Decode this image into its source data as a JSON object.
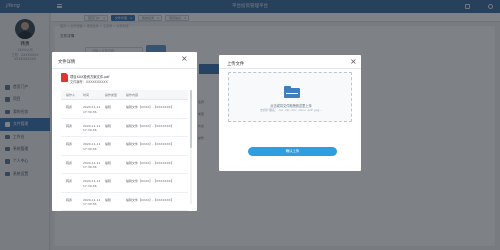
{
  "app": {
    "logo": "jifeng",
    "system_title": "平台投资管理平台"
  },
  "user": {
    "name": "韩勇",
    "line1": "XXXX公司",
    "line2": "工号：XXXXXXXX",
    "line3": "XXXXXXXXXX"
  },
  "sidebar": {
    "items": [
      {
        "label": "首页门户",
        "active": false
      },
      {
        "label": "项目",
        "active": false
      },
      {
        "label": "我的任务",
        "active": false
      },
      {
        "label": "文件管理",
        "active": true
      },
      {
        "label": "工作台",
        "active": false
      },
      {
        "label": "系统管理",
        "active": false
      },
      {
        "label": "个人中心",
        "active": false
      },
      {
        "label": "系统设置",
        "active": false
      }
    ]
  },
  "tabs": [
    {
      "label": "首页门户",
      "active": false
    },
    {
      "label": "文件管理",
      "active": true
    },
    {
      "label": "我的任务",
      "active": false
    },
    {
      "label": "项目信息",
      "active": false
    }
  ],
  "background": {
    "breadcrumb": "首页 > 文件管理 > 项目文件 > 子目录 > 文件列表",
    "page_title": "文件详情",
    "search_placeholder": "请输入文件名称",
    "peek_labels": [
      "名称",
      "类型",
      "状态",
      "操作"
    ]
  },
  "file_modal": {
    "title": "文件详情",
    "file_name": "项目XXX投资方案文件.pdf",
    "file_code": "文件编号：XXXXXXXXXX",
    "columns": [
      "操作人",
      "时间",
      "操作类型",
      "操作内容"
    ],
    "rows": [
      {
        "operator": "韩勇",
        "time": "2020-11-11 17:30:36",
        "type": "编辑",
        "content": "编辑文件【XXXX】-【XXXXXXX】"
      },
      {
        "operator": "韩勇",
        "time": "2020-11-11 17:30:36",
        "type": "编辑",
        "content": "编辑文件【XXXX】-【XXXXXXX】"
      },
      {
        "operator": "韩勇",
        "time": "2020-11-11 17:30:36",
        "type": "编辑",
        "content": "编辑文件【XXXX】-【XXXXXXX】"
      },
      {
        "operator": "韩勇",
        "time": "2020-11-11 17:30:36",
        "type": "编辑",
        "content": "编辑文件【XXXX】-【XXXXXXX】"
      },
      {
        "operator": "韩勇",
        "time": "2020-11-11 17:30:36",
        "type": "编辑",
        "content": "编辑文件【XXXX】-【XXXXXXX】"
      },
      {
        "operator": "韩勇",
        "time": "2020-11-11 17:30:36",
        "type": "编辑",
        "content": "编辑文件【XXXX】-【XXXXXXX】"
      }
    ]
  },
  "upload_modal": {
    "title": "上传文件",
    "hint": "点击或将文件拖拽到这里上传",
    "types": "支持扩展名：.rar .zip .doc .docx .pdf .jpg...",
    "confirm_label": "确认上传"
  },
  "colors": {
    "primary": "#3f76b5",
    "topbar": "#3f6fa3",
    "button": "#2f9ee0",
    "pdf": "#e1342f",
    "overlay": "rgba(20,26,33,0.55)"
  }
}
